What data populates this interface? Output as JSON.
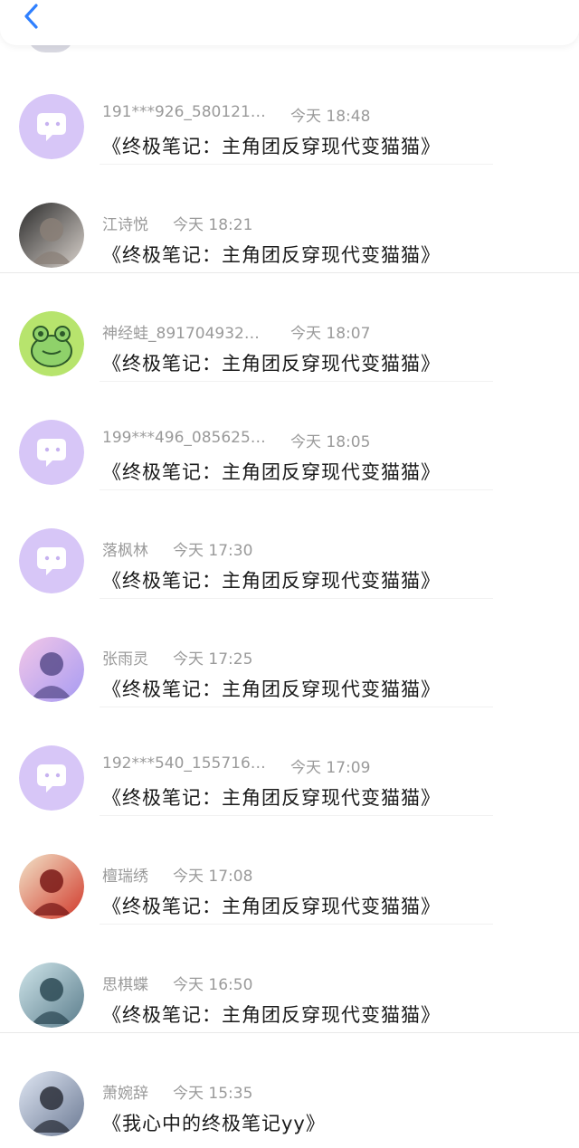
{
  "messages": [
    {
      "name": "191***926_580121…",
      "time": "今天 18:48",
      "text": "《终极笔记：主角团反穿现代变猫猫》",
      "avatar": "bubble-icon"
    },
    {
      "name": "江诗悦",
      "time": "今天 18:21",
      "text": "《终极笔记：主角团反穿现代变猫猫》",
      "avatar": "user-photo"
    },
    {
      "name": "神经蛙_891704932…",
      "time": "今天 18:07",
      "text": "《终极笔记：主角团反穿现代变猫猫》",
      "avatar": "frog-icon"
    },
    {
      "name": "199***496_085625…",
      "time": "今天 18:05",
      "text": "《终极笔记：主角团反穿现代变猫猫》",
      "avatar": "bubble-icon"
    },
    {
      "name": "落枫林",
      "time": "今天 17:30",
      "text": "《终极笔记：主角团反穿现代变猫猫》",
      "avatar": "bubble-icon"
    },
    {
      "name": "张雨灵",
      "time": "今天 17:25",
      "text": "《终极笔记：主角团反穿现代变猫猫》",
      "avatar": "user-photo"
    },
    {
      "name": "192***540_155716…",
      "time": "今天 17:09",
      "text": "《终极笔记：主角团反穿现代变猫猫》",
      "avatar": "bubble-icon"
    },
    {
      "name": "檀瑞绣",
      "time": "今天 17:08",
      "text": "《终极笔记：主角团反穿现代变猫猫》",
      "avatar": "user-photo"
    },
    {
      "name": "思棋蝶",
      "time": "今天 16:50",
      "text": "《终极笔记：主角团反穿现代变猫猫》",
      "avatar": "user-photo"
    },
    {
      "name": "萧婉辞",
      "time": "今天 15:35",
      "text": "《我心中的终极笔记yy》",
      "avatar": "user-photo"
    }
  ],
  "colors": {
    "back_icon": "#2f80ff",
    "bubble_avatar_bg": "#d7c6f7",
    "meta": "#9a9a9a"
  }
}
